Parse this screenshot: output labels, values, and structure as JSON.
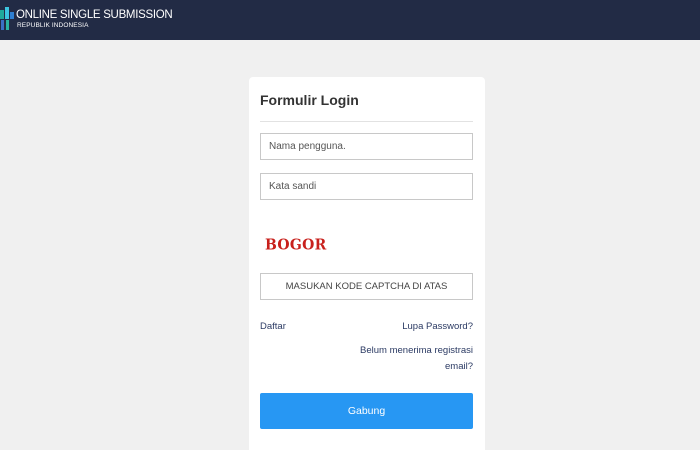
{
  "header": {
    "brand_title": "ONLINE SINGLE SUBMISSION",
    "brand_subtitle": "REPUBLIK INDONESIA",
    "logo_icon": "oss-logo-icon",
    "background": "#222b45"
  },
  "login": {
    "title": "Formulir Login",
    "username_placeholder": "Nama pengguna.",
    "password_placeholder": "Kata sandi",
    "captcha_text": "BOGOR",
    "captcha_placeholder": "MASUKAN KODE CAPTCHA DI ATAS",
    "register_link": "Daftar",
    "forgot_link": "Lupa Password?",
    "resend_link": "Belum menerima registrasi email?",
    "submit_label": "Gabung",
    "accent": "#2797f3",
    "captcha_color": "#c8201c"
  }
}
